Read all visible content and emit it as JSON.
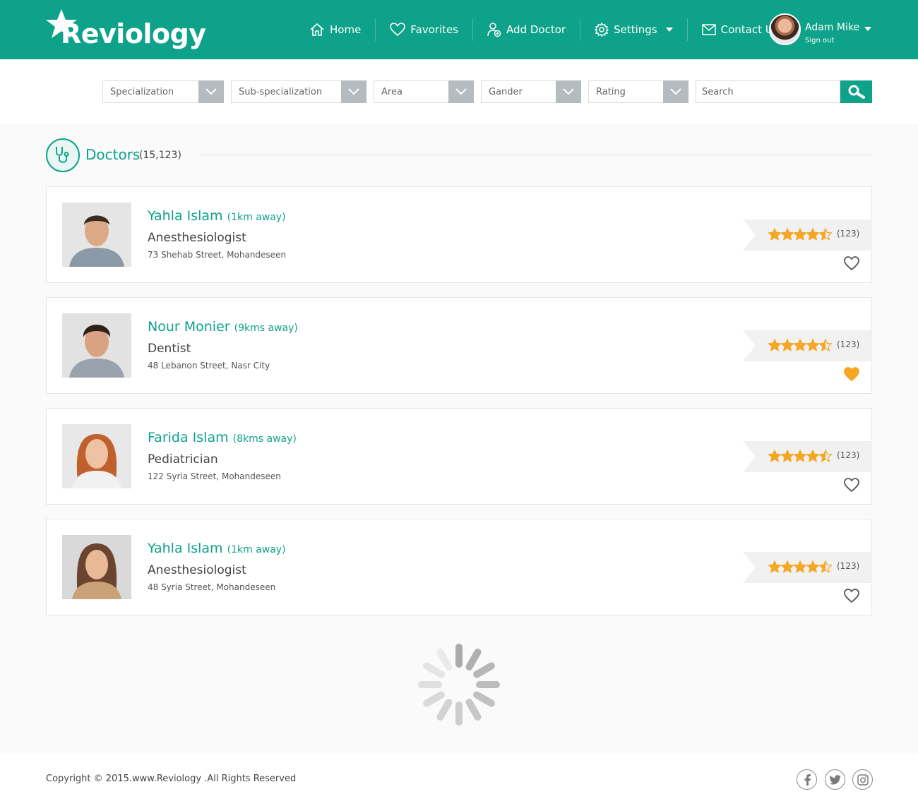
{
  "brand": {
    "name": "Reviology",
    "accent": "#0ea28a",
    "star_color": "#f5a623"
  },
  "nav": {
    "items": [
      {
        "label": "Home",
        "icon": "home-icon"
      },
      {
        "label": "Favorites",
        "icon": "heart-icon"
      },
      {
        "label": "Add Doctor",
        "icon": "add-user-icon"
      },
      {
        "label": "Settings",
        "icon": "gear-icon"
      },
      {
        "label": "Contact Us",
        "icon": "mail-icon"
      }
    ]
  },
  "user": {
    "name": "Adam Mike",
    "signout": "Sign out"
  },
  "filters": {
    "specialization": "Specialization",
    "subspecialization": "Sub-specialization",
    "area": "Area",
    "gender": "Gander",
    "rating": "Rating",
    "search_placeholder": "Search"
  },
  "section": {
    "title": "Doctors",
    "count": "(15,123)"
  },
  "doctors": [
    {
      "name": "Yahla Islam",
      "distance": "(1km away)",
      "specialty": "Anesthesiologist",
      "address": "73 Shehab Street, Mohandeseen",
      "rating": 4.5,
      "reviews": "(123)",
      "favorite": false
    },
    {
      "name": "Nour Monier",
      "distance": "(9kms away)",
      "specialty": "Dentist",
      "address": "48 Lebanon Street, Nasr City",
      "rating": 4.5,
      "reviews": "(123)",
      "favorite": true
    },
    {
      "name": "Farida Islam",
      "distance": "(8kms away)",
      "specialty": "Pediatrician",
      "address": "122 Syria Street, Mohandeseen",
      "rating": 4.5,
      "reviews": "(123)",
      "favorite": false
    },
    {
      "name": "Yahla Islam",
      "distance": "(1km away)",
      "specialty": "Anesthesiologist",
      "address": "48 Syria Street, Mohandeseen",
      "rating": 4.5,
      "reviews": "(123)",
      "favorite": false
    }
  ],
  "footer": {
    "copyright": "Copyright © 2015.www.Reviology .All Rights Reserved",
    "social": [
      "facebook-icon",
      "twitter-icon",
      "instagram-icon"
    ]
  }
}
